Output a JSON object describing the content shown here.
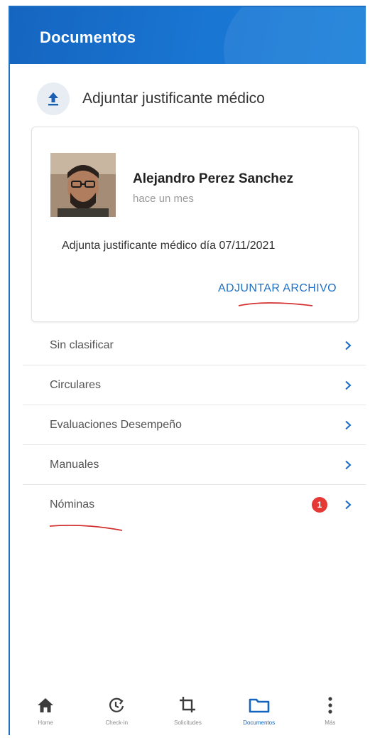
{
  "header": {
    "title": "Documentos"
  },
  "upload": {
    "label": "Adjuntar justificante médico",
    "icon": "upload-icon"
  },
  "card": {
    "name": "Alejandro Perez Sanchez",
    "time": "hace un mes",
    "text": "Adjunta justificante médico día 07/11/2021",
    "action": "ADJUNTAR ARCHIVO"
  },
  "list": {
    "items": [
      {
        "label": "Sin clasificar",
        "badge": ""
      },
      {
        "label": "Circulares",
        "badge": ""
      },
      {
        "label": "Evaluaciones Desempeño",
        "badge": ""
      },
      {
        "label": "Manuales",
        "badge": ""
      },
      {
        "label": "Nóminas",
        "badge": "1"
      }
    ]
  },
  "nav": {
    "items": [
      {
        "label": "Home",
        "icon": "home-icon"
      },
      {
        "label": "Check-in",
        "icon": "check-in-icon"
      },
      {
        "label": "Solicitudes",
        "icon": "crop-icon"
      },
      {
        "label": "Documentos",
        "icon": "folder-icon"
      },
      {
        "label": "Más",
        "icon": "more-vertical-icon"
      }
    ],
    "active_index": 3
  },
  "colors": {
    "brand": "#1565c0",
    "accent": "#1f6fc4",
    "badge": "#e53935",
    "annotation": "#d32f2f"
  }
}
